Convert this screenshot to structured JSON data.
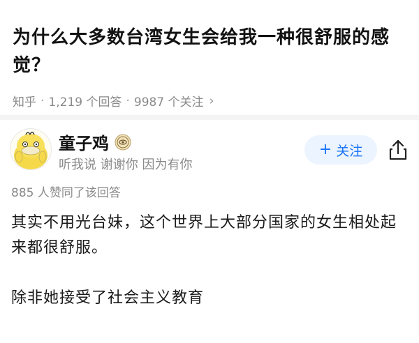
{
  "question": {
    "title": "为什么大多数台湾女生会给我一种很舒服的感觉？",
    "source": "知乎",
    "answers_count": "1,219 个回答",
    "followers_count": "9987 个关注",
    "chevron": "›"
  },
  "author": {
    "name": "童子鸡",
    "bio": "听我说 谢谢你 因为有你",
    "avatar_icon": "yellow-duck-avatar",
    "badge_icon": "eye-badge-icon",
    "follow_label": "关注",
    "follow_plus": "+",
    "share_icon": "share-icon"
  },
  "answer": {
    "votes": "885 人赞同了该回答",
    "paragraphs": [
      "其实不用光台妹，这个世界上大部分国家的女生相处起来都很舒服。",
      "除非她接受了社会主义教育"
    ]
  },
  "colors": {
    "accent": "#1772f6",
    "follow_bg": "#ebf4ff",
    "meta_gray": "#8a8a8a"
  }
}
